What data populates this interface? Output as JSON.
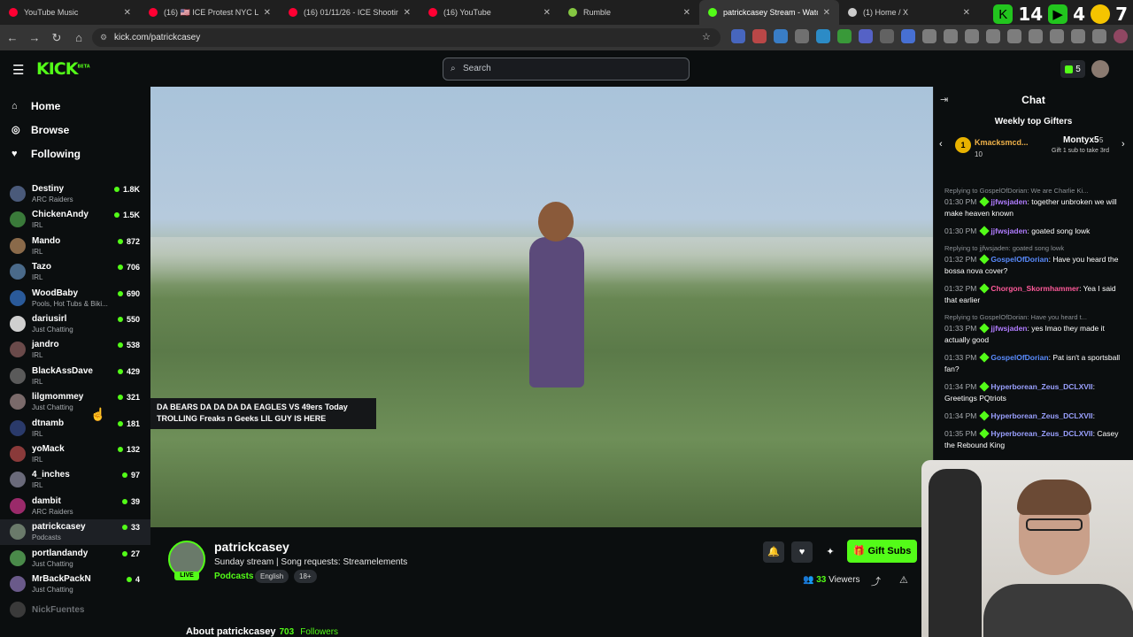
{
  "browser": {
    "tabs": [
      {
        "title": "YouTube Music",
        "color": "#ff0033"
      },
      {
        "title": "(16) 🇺🇸 ICE Protest NYC LA Min",
        "color": "#ff0033"
      },
      {
        "title": "(16) 01/11/26 - ICE Shooting Pr",
        "color": "#ff0033"
      },
      {
        "title": "(16) YouTube",
        "color": "#ff0033"
      },
      {
        "title": "Rumble",
        "color": "#85c742"
      },
      {
        "title": "patrickcasey Stream - Watch",
        "color": "#53fc18"
      },
      {
        "title": "(1) Home / X",
        "color": "#cccccc"
      }
    ],
    "url": "kick.com/patrickcasey",
    "ext_counts": [
      "14",
      "4",
      "7"
    ]
  },
  "header": {
    "logo": "KICK",
    "logo_beta": "BETA",
    "search_placeholder": "Search",
    "kick_points": "5"
  },
  "sidebar": {
    "nav": [
      {
        "label": "Home",
        "icon": "home-icon"
      },
      {
        "label": "Browse",
        "icon": "compass-icon"
      },
      {
        "label": "Following",
        "icon": "heart-icon"
      }
    ],
    "channels": [
      {
        "name": "Destiny",
        "category": "ARC Raiders",
        "viewers": "1.8K",
        "color": "#4a5a7a"
      },
      {
        "name": "ChickenAndy",
        "category": "IRL",
        "viewers": "1.5K",
        "color": "#3a7a3a"
      },
      {
        "name": "Mando",
        "category": "IRL",
        "viewers": "872",
        "color": "#8a6a4a"
      },
      {
        "name": "Tazo",
        "category": "IRL",
        "viewers": "706",
        "color": "#4a6a8a"
      },
      {
        "name": "WoodBaby",
        "category": "Pools, Hot Tubs & Biki...",
        "viewers": "690",
        "color": "#2a5a9a"
      },
      {
        "name": "dariusirl",
        "category": "Just Chatting",
        "viewers": "550",
        "color": "#cfcfcf"
      },
      {
        "name": "jandro",
        "category": "IRL",
        "viewers": "538",
        "color": "#6a4a4a"
      },
      {
        "name": "BlackAssDave",
        "category": "IRL",
        "viewers": "429",
        "color": "#5a5a5a"
      },
      {
        "name": "lilgmommey",
        "category": "Just Chatting",
        "viewers": "321",
        "color": "#7a6a6a"
      },
      {
        "name": "dtnamb",
        "category": "IRL",
        "viewers": "181",
        "color": "#2a3a6a"
      },
      {
        "name": "yoMack",
        "category": "IRL",
        "viewers": "132",
        "color": "#8a3a3a"
      },
      {
        "name": "4_inches",
        "category": "IRL",
        "viewers": "97",
        "color": "#6a6a7a"
      },
      {
        "name": "dambit",
        "category": "ARC Raiders",
        "viewers": "39",
        "color": "#9a2a6a"
      },
      {
        "name": "patrickcasey",
        "category": "Podcasts",
        "viewers": "33",
        "color": "#6a7a6a"
      },
      {
        "name": "portlandandy",
        "category": "Just Chatting",
        "viewers": "27",
        "color": "#4a8a4a"
      },
      {
        "name": "MrBackPackN",
        "category": "Just Chatting",
        "viewers": "4",
        "color": "#6a5a8a"
      },
      {
        "name": "NickFuentes",
        "category": "",
        "viewers": "",
        "color": "#3a3a3a"
      }
    ]
  },
  "player": {
    "tooltip": "DA BEARS DA DA DA DA EAGLES VS 49ers Today TROLLING Freaks n Geeks LIL GUY IS HERE"
  },
  "channel": {
    "name": "patrickcasey",
    "live": "LIVE",
    "stream_title": "Sunday stream | Song requests: Streamelements",
    "category": "Podcasts",
    "tags": [
      "English",
      "18+"
    ],
    "gift_label": "Gift Subs",
    "viewers_count": "33",
    "viewers_label": "Viewers",
    "about_label": "About patrickcasey",
    "followers": "703",
    "followers_label": "Followers"
  },
  "chat": {
    "title": "Chat",
    "gifters_title": "Weekly top Gifters",
    "gifter1": {
      "rank": "1",
      "name": "Kmacksmcd...",
      "count": "10"
    },
    "gifter2": {
      "name": "Montyx5",
      "count": "5",
      "sub": "Gift 1 sub to take 3rd"
    },
    "messages": [
      {
        "reply": "Replying to GospelOfDorian: We are Charlie Ki...",
        "time": "01:30 PM",
        "user": "jjfwsjaden",
        "color": "#b07cff",
        "text": "together unbroken we will make heaven known"
      },
      {
        "reply": "",
        "time": "01:30 PM",
        "user": "jjfwsjaden",
        "color": "#b07cff",
        "text": "goated song lowk"
      },
      {
        "reply": "Replying to jjfwsjaden: goated song lowk",
        "time": "01:32 PM",
        "user": "GospelOfDorian",
        "color": "#5a8cff",
        "text": "Have you heard the bossa nova cover?"
      },
      {
        "reply": "",
        "time": "01:32 PM",
        "user": "Chorgon_Skormhammer",
        "color": "#ff5a9a",
        "text": "Yea I said that earlier"
      },
      {
        "reply": "Replying to GospelOfDorian: Have you heard t...",
        "time": "01:33 PM",
        "user": "jjfwsjaden",
        "color": "#b07cff",
        "text": "yes lmao they made it actually good"
      },
      {
        "reply": "",
        "time": "01:33 PM",
        "user": "GospelOfDorian",
        "color": "#5a8cff",
        "text": "Pat isn't a sportsball fan?"
      },
      {
        "reply": "",
        "time": "01:34 PM",
        "user": "Hyperborean_Zeus_DCLXVII",
        "color": "#9aa0ff",
        "text": "Greetings PQtriots"
      },
      {
        "reply": "",
        "time": "01:34 PM",
        "user": "Hyperborean_Zeus_DCLXVII",
        "color": "#9aa0ff",
        "text": ""
      },
      {
        "reply": "",
        "time": "01:35 PM",
        "user": "Hyperborean_Zeus_DCLXVII",
        "color": "#9aa0ff",
        "text": "Casey the Rebound King"
      }
    ]
  }
}
